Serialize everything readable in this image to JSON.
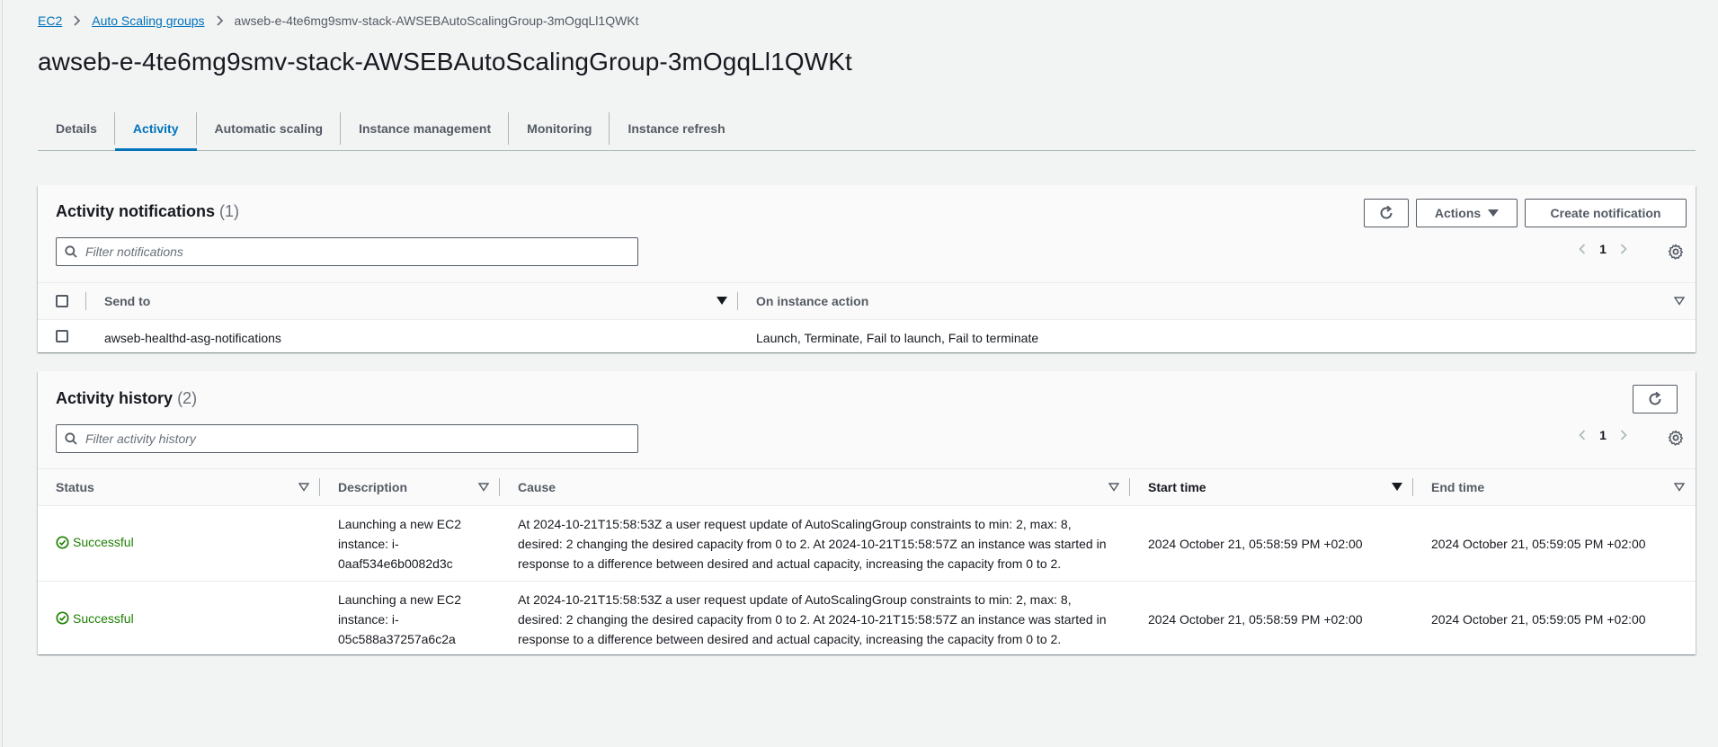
{
  "breadcrumb": {
    "items": [
      "EC2",
      "Auto Scaling groups"
    ],
    "current": "awseb-e-4te6mg9smv-stack-AWSEBAutoScalingGroup-3mOgqLl1QWKt"
  },
  "page_title": "awseb-e-4te6mg9smv-stack-AWSEBAutoScalingGroup-3mOgqLl1QWKt",
  "tabs": [
    {
      "label": "Details"
    },
    {
      "label": "Activity",
      "active": true
    },
    {
      "label": "Automatic scaling"
    },
    {
      "label": "Instance management"
    },
    {
      "label": "Monitoring"
    },
    {
      "label": "Instance refresh"
    }
  ],
  "notifications": {
    "title": "Activity notifications",
    "count": "(1)",
    "actions_label": "Actions",
    "create_label": "Create notification",
    "filter_placeholder": "Filter notifications",
    "page": "1",
    "columns": [
      "Send to",
      "On instance action"
    ],
    "rows": [
      {
        "send_to": "awseb-healthd-asg-notifications",
        "action": "Launch, Terminate, Fail to launch, Fail to terminate"
      }
    ]
  },
  "history": {
    "title": "Activity history",
    "count": "(2)",
    "filter_placeholder": "Filter activity history",
    "page": "1",
    "columns": [
      "Status",
      "Description",
      "Cause",
      "Start time",
      "End time"
    ],
    "rows": [
      {
        "status": "Successful",
        "description": "Launching a new EC2 instance: i-0aaf534e6b0082d3c",
        "cause": "At 2024-10-21T15:58:53Z a user request update of AutoScalingGroup constraints to min: 2, max: 8, desired: 2 changing the desired capacity from 0 to 2. At 2024-10-21T15:58:57Z an instance was started in response to a difference between desired and actual capacity, increasing the capacity from 0 to 2.",
        "start": "2024 October 21, 05:58:59 PM +02:00",
        "end": "2024 October 21, 05:59:05 PM +02:00"
      },
      {
        "status": "Successful",
        "description": "Launching a new EC2 instance: i-05c588a37257a6c2a",
        "cause": "At 2024-10-21T15:58:53Z a user request update of AutoScalingGroup constraints to min: 2, max: 8, desired: 2 changing the desired capacity from 0 to 2. At 2024-10-21T15:58:57Z an instance was started in response to a difference between desired and actual capacity, increasing the capacity from 0 to 2.",
        "start": "2024 October 21, 05:58:59 PM +02:00",
        "end": "2024 October 21, 05:59:05 PM +02:00"
      }
    ]
  },
  "icons": {
    "refresh": "refresh-icon",
    "settings": "gear-icon",
    "search": "search-icon",
    "success": "check-circle-icon"
  },
  "colors": {
    "link": "#0073bb",
    "success": "#1d8102",
    "background": "#f2f3f3",
    "text": "#16191f"
  }
}
